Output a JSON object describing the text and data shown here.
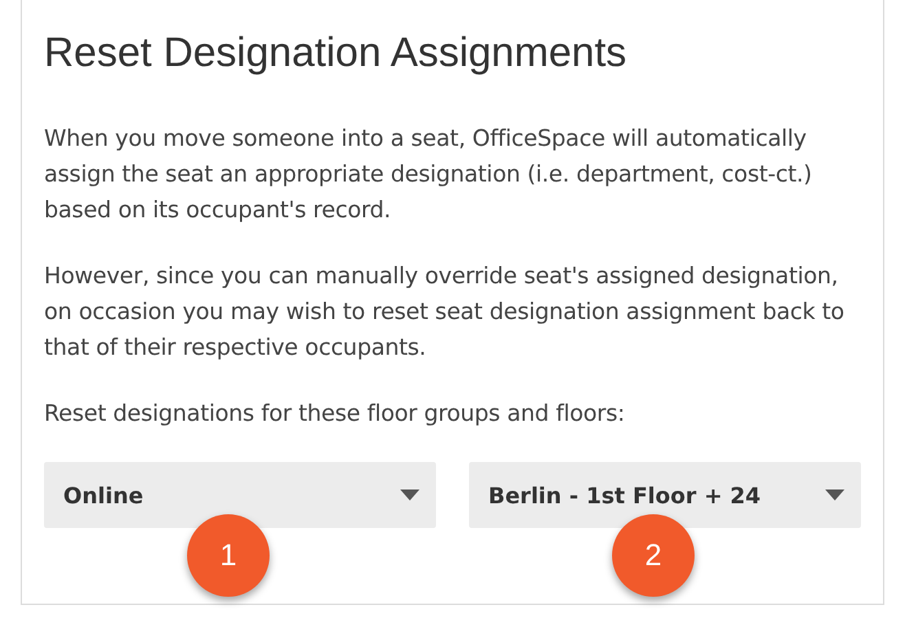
{
  "title": "Reset Designation Assignments",
  "paragraphs": [
    "When you move someone into a seat, OfficeSpace will automatically assign the seat an appropriate designation (i.e. department, cost-ct.) based on its occupant's record.",
    "However, since you can manually override seat's assigned designation, on occasion you may wish to reset seat designation assignment back to that of their respective occupants."
  ],
  "prompt": "Reset designations for these floor groups and floors:",
  "dropdowns": [
    {
      "value": "Online",
      "badge": "1"
    },
    {
      "value": "Berlin - 1st Floor + 24",
      "badge": "2"
    }
  ]
}
